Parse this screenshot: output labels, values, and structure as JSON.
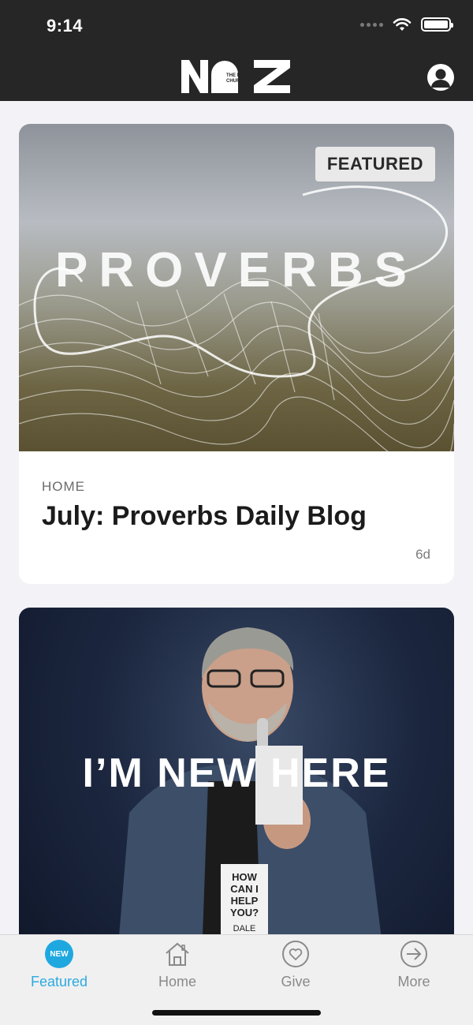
{
  "status_bar": {
    "time": "9:14"
  },
  "header": {
    "logo_text": "NAZ",
    "logo_subtext": "THE NAZ CHURCH"
  },
  "feed": {
    "cards": [
      {
        "hero_text": "PROVERBS",
        "badge": "FEATURED",
        "category": "HOME",
        "title": "July: Proverbs Daily Blog",
        "age": "6d"
      },
      {
        "hero_text": "I’M NEW HERE"
      }
    ]
  },
  "tab_bar": {
    "tabs": [
      {
        "label": "Featured",
        "icon": "new-badge-icon",
        "badge": "NEW",
        "active": true
      },
      {
        "label": "Home",
        "icon": "home-icon",
        "active": false
      },
      {
        "label": "Give",
        "icon": "heart-icon",
        "active": false
      },
      {
        "label": "More",
        "icon": "arrow-right-icon",
        "active": false
      }
    ]
  },
  "colors": {
    "header_bg": "#262626",
    "accent": "#2baae1",
    "background": "#f2f2f7"
  }
}
